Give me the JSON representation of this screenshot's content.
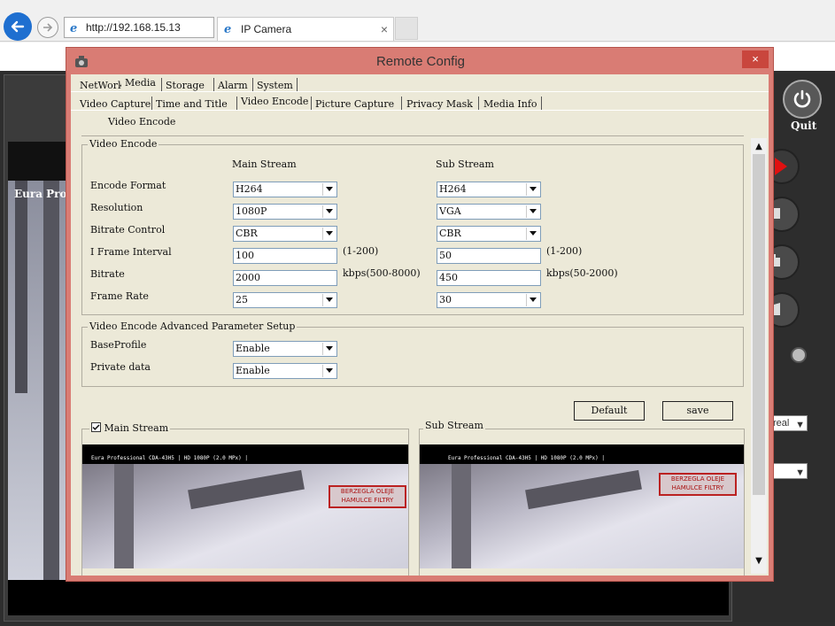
{
  "browser": {
    "address": "http://192.168.15.13",
    "tab_title": "IP Camera",
    "tab_close": "×"
  },
  "background_app": {
    "video_label": "Eura Pro",
    "quit_label": "Quit",
    "select1_value": "real",
    "select2_value": ""
  },
  "dialog": {
    "title": "Remote Config",
    "close_label": "×",
    "tabs_row1": [
      "NetWork",
      "Media",
      "Storage",
      "Alarm",
      "System"
    ],
    "active_tab_row1": "Media",
    "tabs_row2": [
      "Video Capture",
      "Time and Title",
      "Video Encode",
      "Picture Capture",
      "Privacy Mask",
      "Media Info"
    ],
    "active_tab_row2": "Video Encode",
    "section_header": "Video Encode"
  },
  "video_encode": {
    "group_title": "Video Encode",
    "main_stream_header": "Main Stream",
    "sub_stream_header": "Sub Stream",
    "rows": [
      {
        "label": "Encode Format",
        "type": "combo",
        "main": "H264",
        "sub": "H264",
        "main_hint": "",
        "sub_hint": ""
      },
      {
        "label": "Resolution",
        "type": "combo",
        "main": "1080P",
        "sub": "VGA",
        "main_hint": "",
        "sub_hint": ""
      },
      {
        "label": "Bitrate Control",
        "type": "combo",
        "main": "CBR",
        "sub": "CBR",
        "main_hint": "",
        "sub_hint": ""
      },
      {
        "label": "I Frame Interval",
        "type": "text",
        "main": "100",
        "sub": "50",
        "main_hint": "(1-200)",
        "sub_hint": "(1-200)"
      },
      {
        "label": "Bitrate",
        "type": "text",
        "main": "2000",
        "sub": "450",
        "main_hint": "kbps(500-8000)",
        "sub_hint": "kbps(50-2000)"
      },
      {
        "label": "Frame Rate",
        "type": "combo",
        "main": "25",
        "sub": "30",
        "main_hint": "",
        "sub_hint": ""
      }
    ]
  },
  "advanced": {
    "group_title": "Video Encode Advanced Parameter Setup",
    "rows": [
      {
        "label": "BaseProfile",
        "value": "Enable"
      },
      {
        "label": "Private data",
        "value": "Enable"
      }
    ]
  },
  "buttons": {
    "default_label": "Default",
    "save_label": "save"
  },
  "preview": {
    "main_title": "Main Stream",
    "main_checked": true,
    "sub_title": "Sub Stream",
    "osd_text": "Eura Professional CDA-43H5 | HD 1080P (2.0 MPx) |",
    "banner_text": "BERZEGLA OLEJE HAMULCE FILTRY"
  },
  "colors": {
    "dialog_frame": "#d97c74",
    "dialog_bg": "#ece9d8",
    "close_button": "#c9463d",
    "back_button": "#1e6fd0"
  },
  "icons": {
    "back": "arrow-left-icon",
    "forward": "arrow-right-icon",
    "ie": "ie-logo-icon",
    "dialog": "camera-icon",
    "quit": "power-icon"
  }
}
